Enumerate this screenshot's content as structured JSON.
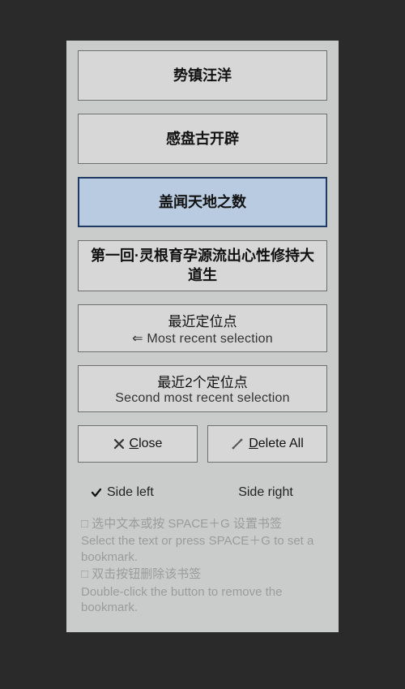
{
  "bookmarks": [
    {
      "label": "势镇汪洋",
      "selected": false
    },
    {
      "label": "感盘古开辟",
      "selected": false
    },
    {
      "label": "盖闻天地之数",
      "selected": true
    },
    {
      "label": "第一回·灵根育孕源流出心性修持大道生",
      "selected": false
    }
  ],
  "recent": [
    {
      "title": "最近定位点",
      "sub_prefix": "⇐ ",
      "sub": "Most recent selection"
    },
    {
      "title": "最近2个定位点",
      "sub_prefix": "",
      "sub": "Second most recent selection"
    }
  ],
  "buttons": {
    "close": {
      "pre": "",
      "underline": "C",
      "post": "lose"
    },
    "delete_all": {
      "pre": "",
      "underline": "D",
      "post": "elete All"
    }
  },
  "options": {
    "left": {
      "label": "Side left",
      "checked": true
    },
    "right": {
      "label": "Side right",
      "checked": false
    }
  },
  "hints": [
    {
      "cn": "选中文本或按 SPACE＋G 设置书签",
      "en": "Select the text or press SPACE＋G to set a bookmark."
    },
    {
      "cn": "双击按钮删除该书签",
      "en": "Double-click the button to remove the bookmark."
    }
  ]
}
